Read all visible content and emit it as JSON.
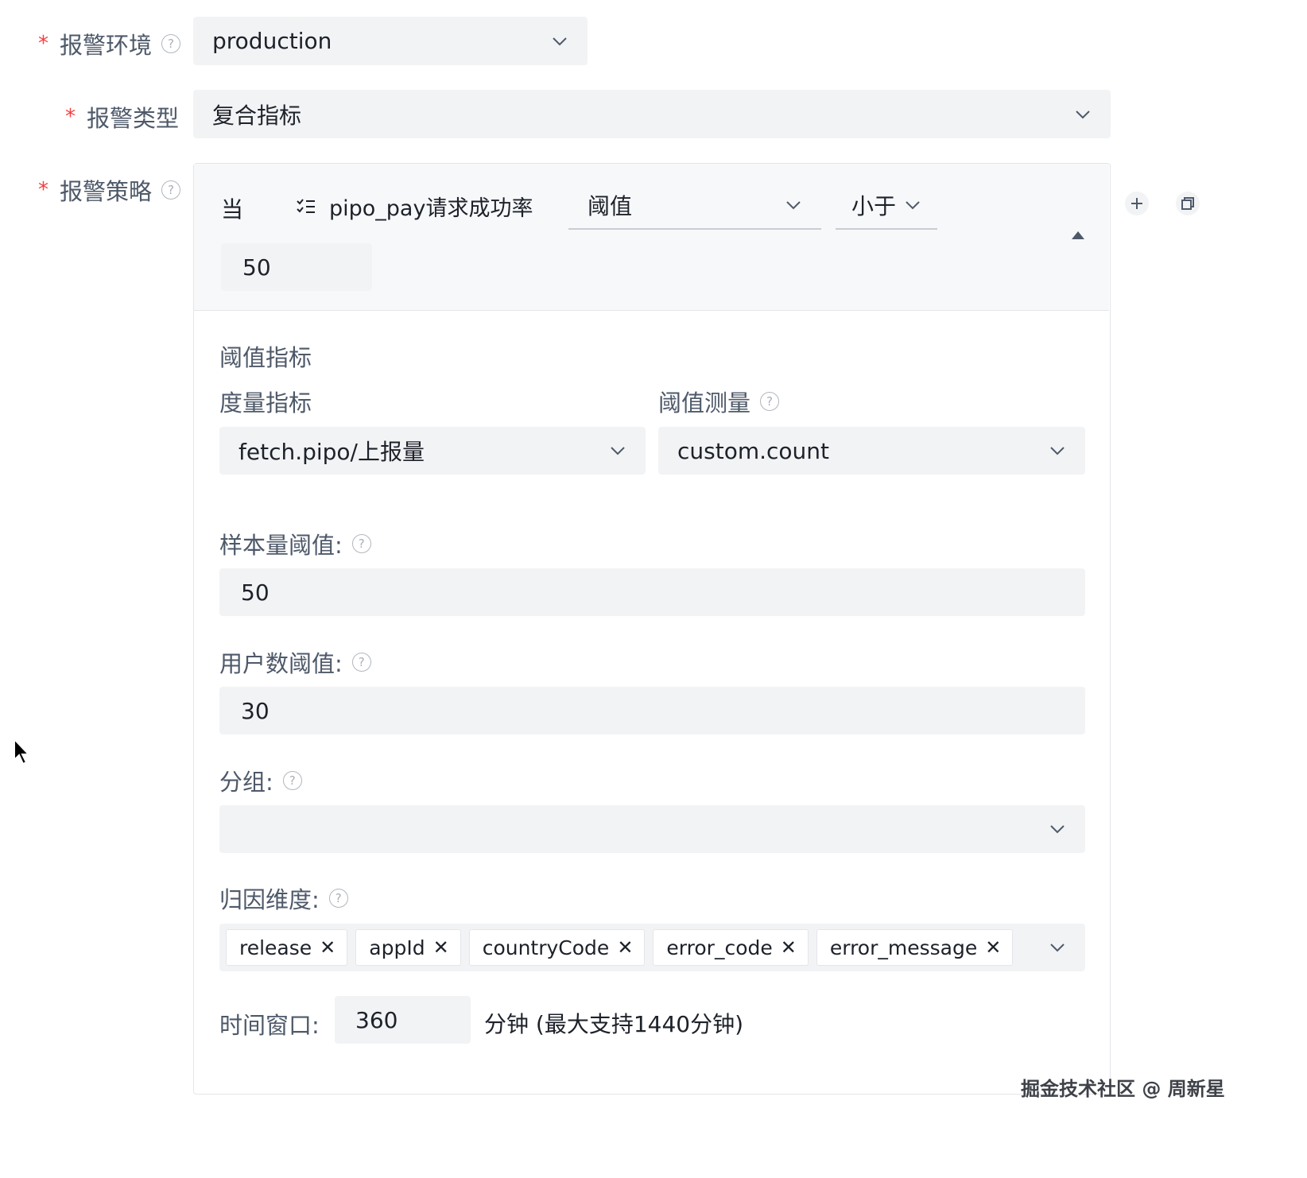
{
  "form": {
    "env": {
      "label": "报警环境",
      "value": "production"
    },
    "type": {
      "label": "报警类型",
      "value": "复合指标"
    },
    "strategy": {
      "label": "报警策略",
      "when": "当",
      "metric_name": "pipo_pay请求成功率",
      "condition": "阈值",
      "operator": "小于",
      "value": "50",
      "section_title": "阈值指标",
      "measure_label": "度量指标",
      "measure_value": "fetch.pipo/上报量",
      "threshold_measure_label": "阈值测量",
      "threshold_measure_value": "custom.count",
      "sample_label": "样本量阈值:",
      "sample_value": "50",
      "users_label": "用户数阈值:",
      "users_value": "30",
      "group_label": "分组:",
      "group_value": "",
      "attr_label": "归因维度:",
      "attr_tags": [
        "release",
        "appId",
        "countryCode",
        "error_code",
        "error_message"
      ],
      "window_label": "时间窗口:",
      "window_value": "360",
      "window_suffix": "分钟 (最大支持1440分钟)"
    }
  },
  "watermark": "掘金技术社区 @ 周新星",
  "icons": [
    "help-icon",
    "chevron-down-icon",
    "list-icon",
    "plus-icon",
    "copy-icon",
    "caret-up-icon",
    "close-icon",
    "mouse-cursor-icon"
  ]
}
